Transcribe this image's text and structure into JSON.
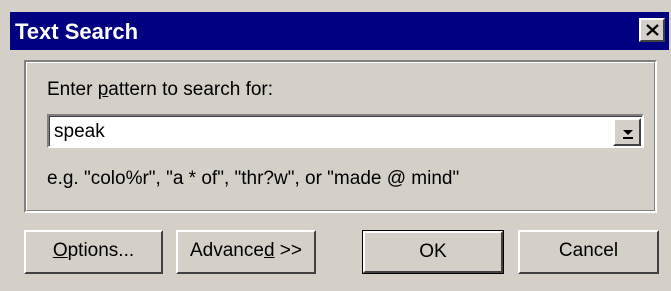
{
  "window": {
    "title": "Text Search"
  },
  "search": {
    "prompt_pre": "Enter ",
    "prompt_accel": "p",
    "prompt_post": "attern to search for:",
    "value": "speak",
    "example": "e.g. \"colo%r\", \"a * of\", \"thr?w\", or \"made @ mind\""
  },
  "buttons": {
    "options_accel": "O",
    "options_rest": "ptions...",
    "advanced_pre": "Advance",
    "advanced_accel": "d",
    "advanced_post": " >>",
    "ok": "OK",
    "cancel": "Cancel"
  },
  "icons": {
    "close": "close-icon",
    "dropdown": "chevron-down-icon"
  },
  "colors": {
    "titlebar": "#000080",
    "face": "#d4d0c8"
  }
}
